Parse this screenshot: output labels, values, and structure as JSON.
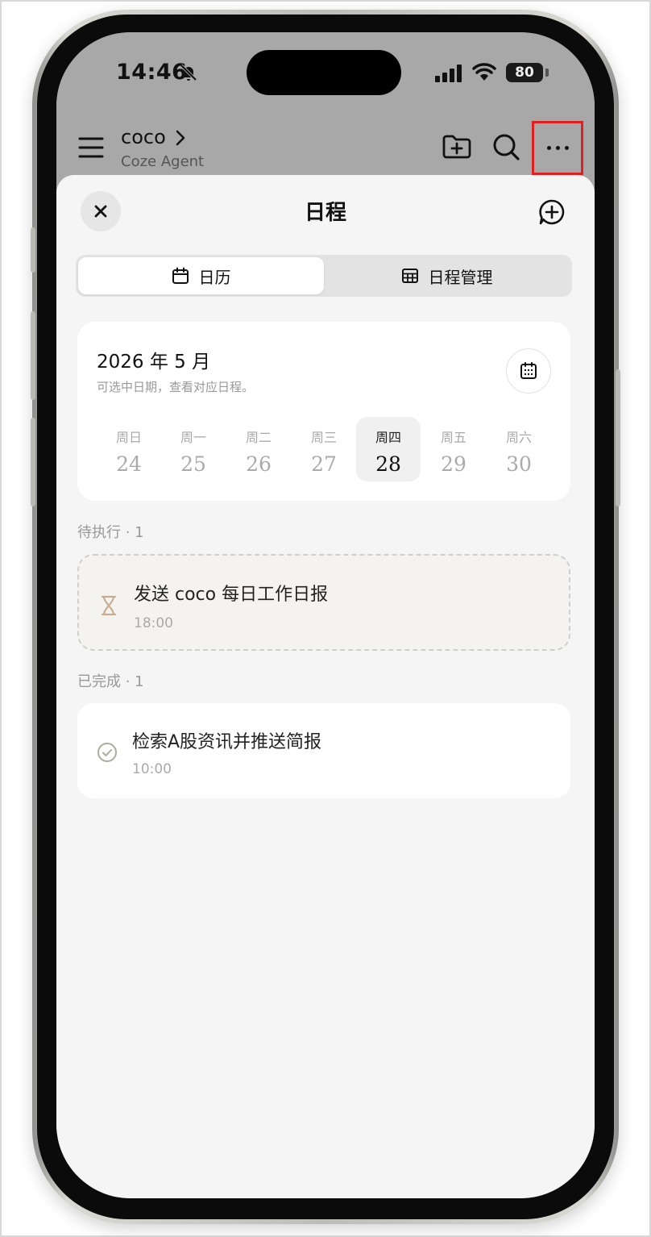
{
  "status_bar": {
    "time": "14:46",
    "battery": "80",
    "icons": [
      "bell-off-icon",
      "signal-icon",
      "wifi-icon",
      "battery-icon"
    ]
  },
  "header": {
    "agent_name": "coco",
    "agent_subtitle": "Coze Agent",
    "icons": [
      "menu-icon",
      "chevron-right-icon",
      "folder-add-icon",
      "search-icon",
      "more-icon"
    ],
    "highlight_color": "#e02020"
  },
  "sheet": {
    "title": "日程",
    "icons": [
      "close-icon",
      "add-chat-icon"
    ]
  },
  "tabs": [
    {
      "label": "日历",
      "icon": "calendar-icon",
      "active": true
    },
    {
      "label": "日程管理",
      "icon": "grid-icon",
      "active": false
    }
  ],
  "calendar": {
    "month_title": "2026 年 5 月",
    "hint": "可选中日期，查看对应日程。",
    "picker_icon": "calendar-grid-icon",
    "days": [
      {
        "weekday": "周日",
        "date": "24",
        "selected": false
      },
      {
        "weekday": "周一",
        "date": "25",
        "selected": false
      },
      {
        "weekday": "周二",
        "date": "26",
        "selected": false
      },
      {
        "weekday": "周三",
        "date": "27",
        "selected": false
      },
      {
        "weekday": "周四",
        "date": "28",
        "selected": true
      },
      {
        "weekday": "周五",
        "date": "29",
        "selected": false
      },
      {
        "weekday": "周六",
        "date": "30",
        "selected": false
      }
    ]
  },
  "pending": {
    "label": "待执行 · 1",
    "items": [
      {
        "title": "发送 coco 每日工作日报",
        "time": "18:00",
        "icon": "hourglass-icon"
      }
    ]
  },
  "completed": {
    "label": "已完成 · 1",
    "items": [
      {
        "title": "检索A股资讯并推送简报",
        "time": "10:00",
        "icon": "check-circle-icon"
      }
    ]
  }
}
